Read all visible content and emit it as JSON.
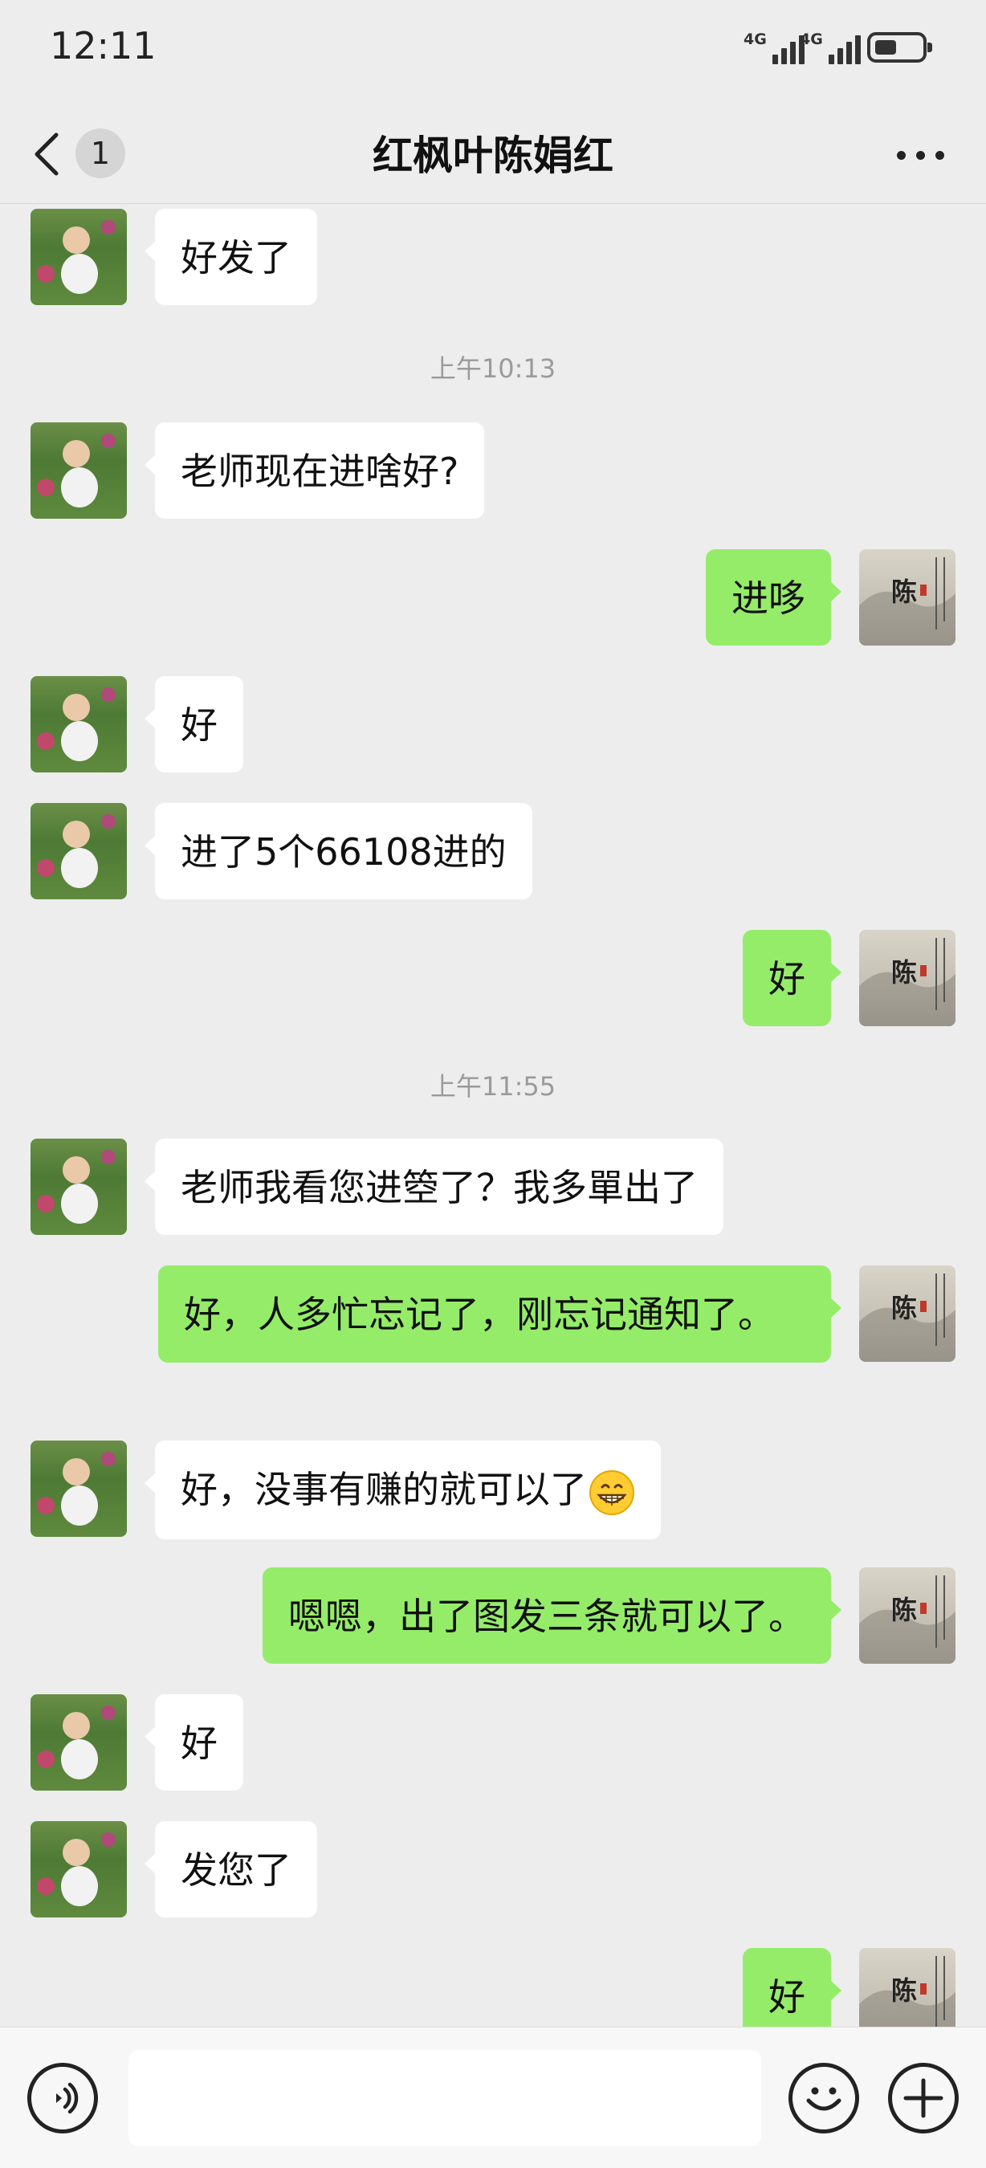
{
  "status_bar": {
    "time": "12:11",
    "signal_1_label": "4G",
    "signal_2_label": "4G"
  },
  "nav": {
    "back_icon": "back-arrow-icon",
    "unread_count": "1",
    "title": "红枫叶陈娟红",
    "more_icon": "more-dots-icon"
  },
  "messages": [
    {
      "side": "in",
      "text": "好发了"
    },
    {
      "timestamp": "上午10:13"
    },
    {
      "side": "in",
      "text": "老师现在进啥好?"
    },
    {
      "side": "out",
      "text": "进哆"
    },
    {
      "side": "in",
      "text": "好"
    },
    {
      "side": "in",
      "text": "进了5个66108进的"
    },
    {
      "side": "out",
      "text": "好"
    },
    {
      "timestamp": "上午11:55"
    },
    {
      "side": "in",
      "text": "老师我看您进箜了？我多單出了"
    },
    {
      "side": "out",
      "text": "好，人多忙忘记了，刚忘记通知了。"
    },
    {
      "side": "in",
      "text": "好，没事有赚的就可以了",
      "emoji": "grinning-face-emoji"
    },
    {
      "side": "out",
      "text": "嗯嗯，出了图发三条就可以了。"
    },
    {
      "side": "in",
      "text": "好"
    },
    {
      "side": "in",
      "text": "发您了"
    },
    {
      "side": "out",
      "text": "好"
    }
  ],
  "input_bar": {
    "voice_icon": "voice-icon",
    "text_value": "",
    "emoji_icon": "emoji-icon",
    "plus_icon": "plus-icon"
  },
  "colors": {
    "background": "#ededed",
    "incoming_bubble": "#ffffff",
    "outgoing_bubble": "#95ec69",
    "timestamp_text": "#9a9a9a"
  }
}
